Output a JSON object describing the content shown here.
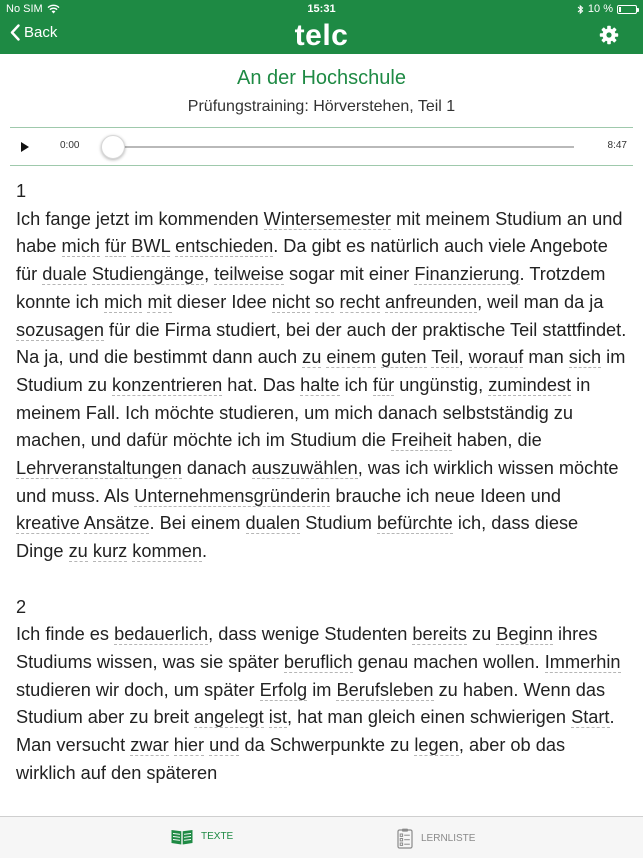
{
  "status_bar": {
    "carrier": "No SIM",
    "time": "15:31",
    "battery": "10 %"
  },
  "nav": {
    "back_label": "Back",
    "app_title": "telc",
    "settings_icon": "gear-icon"
  },
  "header": {
    "title": "An der Hochschule",
    "subtitle": "Prüfungstraining: Hörverstehen, Teil 1"
  },
  "player": {
    "current_time": "0:00",
    "total_time": "8:47",
    "progress": 0
  },
  "paragraphs": [
    {
      "number": "1",
      "segments": [
        {
          "t": "Ich fange jetzt im kommenden "
        },
        {
          "t": "Wintersemester",
          "u": true
        },
        {
          "t": " mit meinem Studium an und habe "
        },
        {
          "t": "mich",
          "u": true
        },
        {
          "t": " "
        },
        {
          "t": "für",
          "u": true
        },
        {
          "t": " "
        },
        {
          "t": "BWL",
          "u": true
        },
        {
          "t": " "
        },
        {
          "t": "entschieden",
          "u": true
        },
        {
          "t": ". Da gibt es natürlich auch viele Angebote für "
        },
        {
          "t": "duale",
          "u": true
        },
        {
          "t": " "
        },
        {
          "t": "Studiengänge",
          "u": true
        },
        {
          "t": ", "
        },
        {
          "t": "teilweise",
          "u": true
        },
        {
          "t": " sogar mit einer "
        },
        {
          "t": "Finanzierung",
          "u": true
        },
        {
          "t": ". Trotzdem konnte ich "
        },
        {
          "t": "mich",
          "u": true
        },
        {
          "t": " "
        },
        {
          "t": "mit",
          "u": true
        },
        {
          "t": " dieser Idee "
        },
        {
          "t": "nicht",
          "u": true
        },
        {
          "t": " "
        },
        {
          "t": "so",
          "u": true
        },
        {
          "t": " "
        },
        {
          "t": "recht",
          "u": true
        },
        {
          "t": " "
        },
        {
          "t": "anfreunden",
          "u": true
        },
        {
          "t": ", weil man da ja "
        },
        {
          "t": "sozusagen",
          "u": true
        },
        {
          "t": " für die Firma studiert, bei der auch der praktische Teil stattfindet. Na ja, und die bestimmt dann auch "
        },
        {
          "t": "zu",
          "u": true
        },
        {
          "t": " "
        },
        {
          "t": "einem",
          "u": true
        },
        {
          "t": " "
        },
        {
          "t": "guten",
          "u": true
        },
        {
          "t": " "
        },
        {
          "t": "Teil",
          "u": true
        },
        {
          "t": ", "
        },
        {
          "t": "worauf",
          "u": true
        },
        {
          "t": " man "
        },
        {
          "t": "sich",
          "u": true
        },
        {
          "t": " im Studium zu "
        },
        {
          "t": "konzentrieren",
          "u": true
        },
        {
          "t": " hat. Das "
        },
        {
          "t": "halte",
          "u": true
        },
        {
          "t": " ich "
        },
        {
          "t": "für",
          "u": true
        },
        {
          "t": " ungünstig, "
        },
        {
          "t": "zumindest",
          "u": true
        },
        {
          "t": " in meinem Fall. Ich möchte studieren, um mich danach selbstständig zu machen, und dafür möchte ich im Studium die "
        },
        {
          "t": "Freiheit",
          "u": true
        },
        {
          "t": " haben, die "
        },
        {
          "t": "Lehrveranstaltungen",
          "u": true
        },
        {
          "t": " danach "
        },
        {
          "t": "auszuwählen",
          "u": true
        },
        {
          "t": ", was ich wirklich wissen möchte und muss. Als "
        },
        {
          "t": "Unternehmensgründerin",
          "u": true
        },
        {
          "t": " brauche ich neue Ideen und "
        },
        {
          "t": "kreative",
          "u": true
        },
        {
          "t": " "
        },
        {
          "t": "Ansätze",
          "u": true
        },
        {
          "t": ". Bei einem "
        },
        {
          "t": "dualen",
          "u": true
        },
        {
          "t": " Studium "
        },
        {
          "t": "befürchte",
          "u": true
        },
        {
          "t": " ich, dass diese Dinge "
        },
        {
          "t": "zu",
          "u": true
        },
        {
          "t": " "
        },
        {
          "t": "kurz",
          "u": true
        },
        {
          "t": " "
        },
        {
          "t": "kommen",
          "u": true
        },
        {
          "t": "."
        }
      ]
    },
    {
      "number": "2",
      "segments": [
        {
          "t": "Ich finde es "
        },
        {
          "t": "bedauerlich",
          "u": true
        },
        {
          "t": ", dass wenige Studenten "
        },
        {
          "t": "bereits",
          "u": true
        },
        {
          "t": " zu "
        },
        {
          "t": "Beginn",
          "u": true
        },
        {
          "t": " ihres Studiums wissen, was sie später "
        },
        {
          "t": "beruflich",
          "u": true
        },
        {
          "t": " genau machen wollen. "
        },
        {
          "t": "Immerhin",
          "u": true
        },
        {
          "t": " studieren wir doch, um später "
        },
        {
          "t": "Erfolg",
          "u": true
        },
        {
          "t": " im "
        },
        {
          "t": "Berufsleben",
          "u": true
        },
        {
          "t": " zu haben. Wenn das Studium aber zu breit "
        },
        {
          "t": "angelegt",
          "u": true
        },
        {
          "t": " "
        },
        {
          "t": "ist",
          "u": true
        },
        {
          "t": ", hat man gleich einen schwierigen "
        },
        {
          "t": "Start",
          "u": true
        },
        {
          "t": ". Man versucht "
        },
        {
          "t": "zwar",
          "u": true
        },
        {
          "t": " "
        },
        {
          "t": "hier",
          "u": true
        },
        {
          "t": " "
        },
        {
          "t": "und",
          "u": true
        },
        {
          "t": " da Schwerpunkte zu "
        },
        {
          "t": "legen",
          "u": true
        },
        {
          "t": ", aber ob das wirklich auf den späteren"
        }
      ]
    }
  ],
  "tabs": [
    {
      "label": "TEXTE",
      "icon": "book-icon",
      "active": true
    },
    {
      "label": "LERNLISTE",
      "icon": "checklist-icon",
      "active": false
    }
  ],
  "colors": {
    "brand": "#1e8a44",
    "tab_inactive": "#8a8a8a",
    "underline": "#b6b6b6"
  }
}
